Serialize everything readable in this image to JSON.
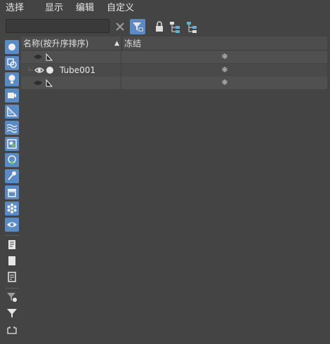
{
  "menubar": {
    "items": [
      "选择",
      "显示",
      "编辑",
      "自定义"
    ]
  },
  "toolbar": {
    "search_value": "",
    "search_placeholder": ""
  },
  "table": {
    "columns": {
      "name": "名称(按升序排序)",
      "sort_indicator": "▲",
      "freeze": "冻结"
    },
    "rows": [
      {
        "label": "",
        "visible": false,
        "freeze_icon": "❄"
      },
      {
        "label": "Tube001",
        "visible": true,
        "freeze_icon": "❄"
      },
      {
        "label": "",
        "visible": false,
        "freeze_icon": "❄"
      }
    ]
  },
  "sidebar": {
    "icons": [
      "display-geometry-icon",
      "display-shapes-icon",
      "display-lights-icon",
      "display-cameras-icon",
      "display-helpers-icon",
      "display-spacewarps-icon",
      "display-groups-icon",
      "display-xrefs-icon",
      "display-bones-icon",
      "display-containers-icon",
      "display-frozen-icon",
      "display-hidden-icon",
      "display-all-icon",
      "display-none-icon",
      "invert-display-icon",
      "filter-settings-icon",
      "selection-filter-icon",
      "layer-icon"
    ]
  }
}
